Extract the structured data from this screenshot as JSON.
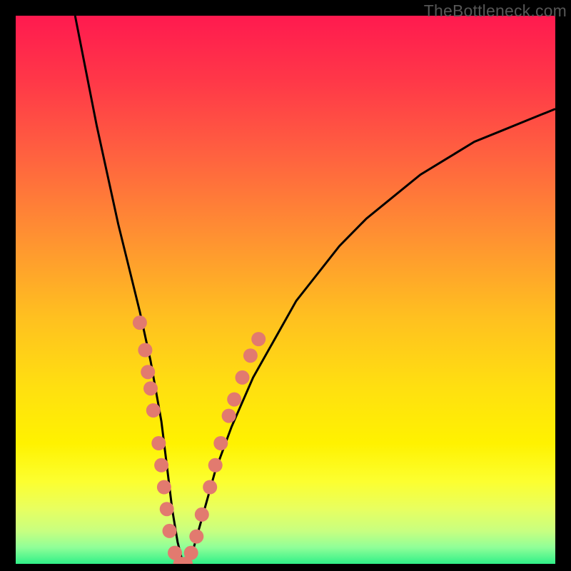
{
  "watermark": "TheBottleneck.com",
  "gradient": {
    "stops": [
      {
        "offset": 0.0,
        "color": "#ff1a4f"
      },
      {
        "offset": 0.12,
        "color": "#ff3848"
      },
      {
        "offset": 0.25,
        "color": "#ff6040"
      },
      {
        "offset": 0.4,
        "color": "#ff9032"
      },
      {
        "offset": 0.55,
        "color": "#ffc020"
      },
      {
        "offset": 0.68,
        "color": "#ffe010"
      },
      {
        "offset": 0.78,
        "color": "#fff200"
      },
      {
        "offset": 0.85,
        "color": "#fcff30"
      },
      {
        "offset": 0.9,
        "color": "#e8ff60"
      },
      {
        "offset": 0.94,
        "color": "#c8ff80"
      },
      {
        "offset": 0.97,
        "color": "#90ff98"
      },
      {
        "offset": 1.0,
        "color": "#30f088"
      }
    ]
  },
  "chart_data": {
    "type": "line",
    "title": "",
    "xlabel": "",
    "ylabel": "",
    "xlim": [
      0,
      100
    ],
    "ylim": [
      0,
      100
    ],
    "grid": false,
    "legend": false,
    "series": [
      {
        "name": "bottleneck-curve",
        "x": [
          11,
          13,
          15,
          17,
          19,
          21,
          23,
          25,
          27,
          28,
          29,
          30,
          31,
          32,
          33,
          35,
          37,
          40,
          44,
          48,
          52,
          56,
          60,
          65,
          70,
          75,
          80,
          85,
          90,
          95,
          100
        ],
        "y": [
          100,
          90,
          80,
          71,
          62,
          54,
          46,
          37,
          26,
          18,
          10,
          4,
          0,
          0,
          3,
          10,
          17,
          25,
          34,
          41,
          48,
          53,
          58,
          63,
          67,
          71,
          74,
          77,
          79,
          81,
          83
        ]
      }
    ],
    "scatter": [
      {
        "name": "highlight-points",
        "color": "#e27a6f",
        "points": [
          {
            "x": 23.0,
            "y": 44
          },
          {
            "x": 24.0,
            "y": 39
          },
          {
            "x": 24.5,
            "y": 35
          },
          {
            "x": 25.0,
            "y": 32
          },
          {
            "x": 25.5,
            "y": 28
          },
          {
            "x": 26.5,
            "y": 22
          },
          {
            "x": 27.0,
            "y": 18
          },
          {
            "x": 27.5,
            "y": 14
          },
          {
            "x": 28.0,
            "y": 10
          },
          {
            "x": 28.5,
            "y": 6
          },
          {
            "x": 29.5,
            "y": 2
          },
          {
            "x": 30.5,
            "y": 0
          },
          {
            "x": 31.5,
            "y": 0
          },
          {
            "x": 32.5,
            "y": 2
          },
          {
            "x": 33.5,
            "y": 5
          },
          {
            "x": 34.5,
            "y": 9
          },
          {
            "x": 36.0,
            "y": 14
          },
          {
            "x": 37.0,
            "y": 18
          },
          {
            "x": 38.0,
            "y": 22
          },
          {
            "x": 39.5,
            "y": 27
          },
          {
            "x": 40.5,
            "y": 30
          },
          {
            "x": 42.0,
            "y": 34
          },
          {
            "x": 43.5,
            "y": 38
          },
          {
            "x": 45.0,
            "y": 41
          }
        ]
      }
    ]
  }
}
